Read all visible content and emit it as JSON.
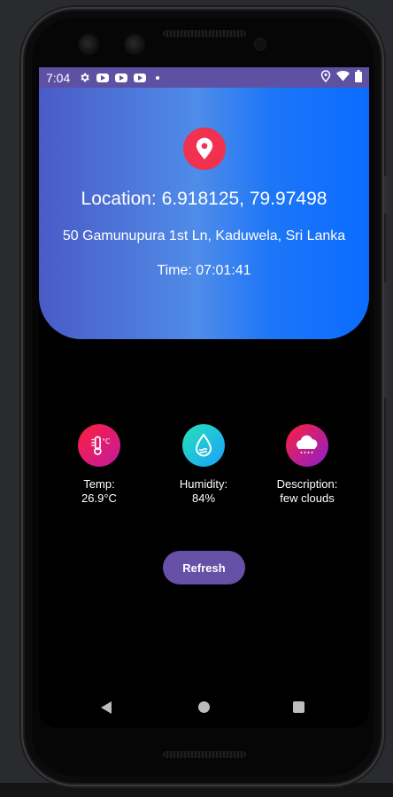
{
  "status_bar": {
    "time": "7:04",
    "icons_left": [
      "settings-icon",
      "youtube-icon",
      "youtube-icon",
      "youtube-icon",
      "dot-icon"
    ],
    "icons_right": [
      "location-icon",
      "wifi-icon",
      "battery-icon"
    ]
  },
  "location": {
    "icon": "location-pin-icon",
    "title": "Location: 6.918125, 79.97498",
    "address": "50 Gamunupura 1st Ln, Kaduwela, Sri Lanka",
    "time": "Time: 07:01:41"
  },
  "weather": {
    "temp": {
      "label": "Temp:",
      "value": "26.9°C",
      "icon": "thermometer-icon"
    },
    "humidity": {
      "label": "Humidity:",
      "value": "84%",
      "icon": "water-drop-icon"
    },
    "description": {
      "label": "Description:",
      "value": "few clouds",
      "icon": "cloud-icon"
    }
  },
  "actions": {
    "refresh_label": "Refresh"
  },
  "colors": {
    "status_bar": "#5e50a3",
    "accent_pin": "#f0314f",
    "button": "#6651a7",
    "gradient_start": "#4a5bc6",
    "gradient_end": "#0a6cff"
  }
}
